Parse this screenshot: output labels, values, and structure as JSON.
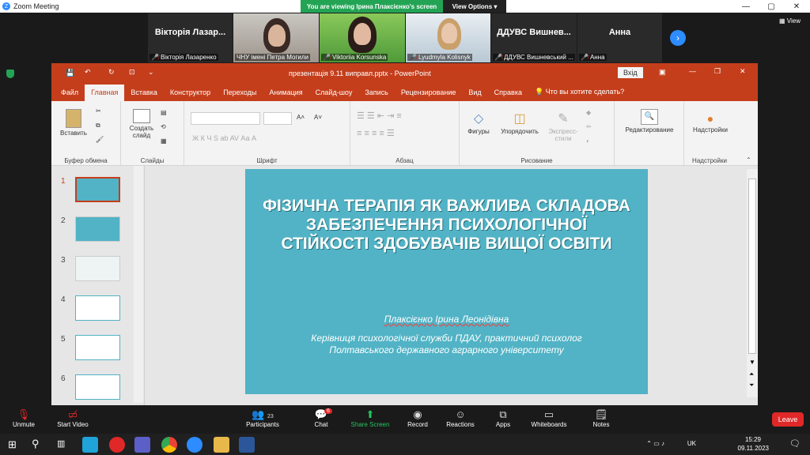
{
  "zoom": {
    "window_title": "Zoom Meeting",
    "share_banner": "You are viewing Ірина Плаксієнко's screen",
    "view_options": "View Options",
    "view_label": "View"
  },
  "participants": [
    {
      "display": "Вікторія Лазар...",
      "label": "Вікторія Лазаренко"
    },
    {
      "display": "",
      "label": "ЧНУ імені Петра Могили"
    },
    {
      "display": "",
      "label": "Viktoriia Korsunska"
    },
    {
      "display": "",
      "label": "Lyudmyla Kolisnyk"
    },
    {
      "display": "ДДУВС Вишнев...",
      "label": "ДДУВС Вишневський ..."
    },
    {
      "display": "Анна",
      "label": "Анна"
    }
  ],
  "ppt": {
    "title": "презентація  9.11 виправл.pptx  -  PowerPoint",
    "login": "Вхід",
    "tabs": [
      "Файл",
      "Главная",
      "Вставка",
      "Конструктор",
      "Переходы",
      "Анимация",
      "Слайд-шоу",
      "Запись",
      "Рецензирование",
      "Вид",
      "Справка"
    ],
    "tell_me": "Что вы хотите сделать?",
    "ribbon": {
      "paste": "Вставить",
      "clipboard": "Буфер обмена",
      "new_slide": "Создать слайд",
      "slides": "Слайды",
      "font": "Шрифт",
      "paragraph": "Абзац",
      "shapes": "Фигуры",
      "arrange": "Упорядочить",
      "quick_styles": "Экспресс-стили",
      "drawing": "Рисование",
      "editing": "Редактирование",
      "addins_btn": "Надстройки",
      "addins": "Надстройки",
      "font_tools": "Ж  К  Ч  S  ab  AV  Аа  A"
    },
    "thumb_numbers": [
      "1",
      "2",
      "3",
      "4",
      "5",
      "6"
    ],
    "slide": {
      "title": "ФІЗИЧНА ТЕРАПІЯ ЯК ВАЖЛИВА СКЛАДОВА ЗАБЕЗПЕЧЕННЯ ПСИХОЛОГІЧНОЇ СТІЙКОСТІ ЗДОБУВАЧІВ ВИЩОЇ ОСВІТИ",
      "author": "Плаксієнко Ірина Леонідівна",
      "role": "Керівниця психологічної служби ПДАУ, практичний психолог Полтавського державного аграрного університету"
    }
  },
  "toolbar": {
    "unmute": "Unmute",
    "start_video": "Start Video",
    "participants": "Participants",
    "participants_count": "23",
    "chat": "Chat",
    "chat_badge": "6",
    "share": "Share Screen",
    "record": "Record",
    "reactions": "Reactions",
    "apps": "Apps",
    "whiteboards": "Whiteboards",
    "notes": "Notes",
    "leave": "Leave"
  },
  "tray": {
    "lang": "UK",
    "time": "15:29",
    "date": "09.11.2023"
  }
}
